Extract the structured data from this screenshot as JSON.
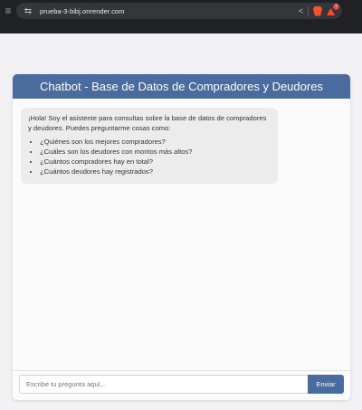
{
  "browser": {
    "url": "prueba-3-bibj.onrender.com",
    "rewards_badge": "1"
  },
  "chat": {
    "title": "Chatbot - Base de Datos de Compradores y Deudores",
    "bot_message": {
      "intro": "¡Hola! Soy el asistente para consultas sobre la base de datos de compradores y deudores. Puedes preguntarme cosas como:",
      "examples": [
        "¿Quiénes son los mejores compradores?",
        "¿Cuáles son los deudores con montos más altos?",
        "¿Cuántos compradores hay en total?",
        "¿Cuántos deudores hay registrados?"
      ]
    },
    "input": {
      "placeholder": "Escribe tu pregunta aquí...",
      "value": ""
    },
    "send_label": "Enviar"
  },
  "colors": {
    "accent": "#4a6b9e",
    "browser_chrome": "#202124",
    "bot_bubble": "#ececec"
  },
  "icons": {
    "menu": "hamburger-icon",
    "site_info": "tune-icon",
    "share": "share-icon",
    "brave": "brave-shield-icon",
    "rewards": "brave-rewards-icon"
  }
}
